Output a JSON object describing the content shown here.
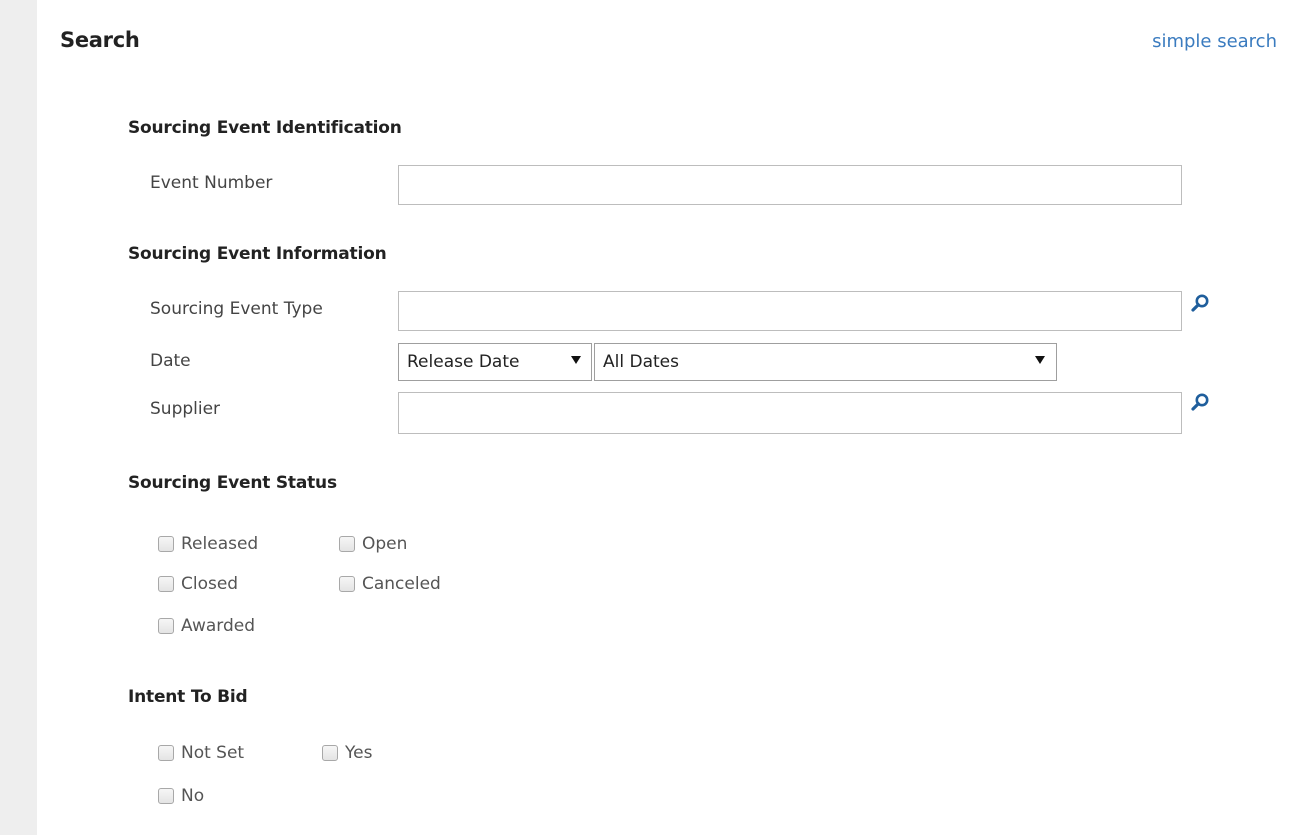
{
  "header": {
    "title": "Search",
    "simple_search_link": "simple search"
  },
  "identification": {
    "heading": "Sourcing Event Identification",
    "event_number": {
      "label": "Event Number",
      "value": "",
      "placeholder": ""
    }
  },
  "information": {
    "heading": "Sourcing Event Information",
    "event_type": {
      "label": "Sourcing Event Type",
      "value": "",
      "icon": "search-icon"
    },
    "date": {
      "label": "Date",
      "date_type_selected": "Release Date",
      "date_range_selected": "All Dates"
    },
    "supplier": {
      "label": "Supplier",
      "value": "",
      "icon": "search-icon"
    }
  },
  "status": {
    "heading": "Sourcing Event Status",
    "options": [
      {
        "label": "Released",
        "checked": false
      },
      {
        "label": "Open",
        "checked": false
      },
      {
        "label": "Closed",
        "checked": false
      },
      {
        "label": "Canceled",
        "checked": false
      },
      {
        "label": "Awarded",
        "checked": false
      }
    ]
  },
  "intent": {
    "heading": "Intent To Bid",
    "options": [
      {
        "label": "Not Set",
        "checked": false
      },
      {
        "label": "Yes",
        "checked": false
      },
      {
        "label": "No",
        "checked": false
      }
    ]
  },
  "colors": {
    "link": "#3a7bbf",
    "icon": "#1f5e9c",
    "rail": "#eeeeee"
  }
}
